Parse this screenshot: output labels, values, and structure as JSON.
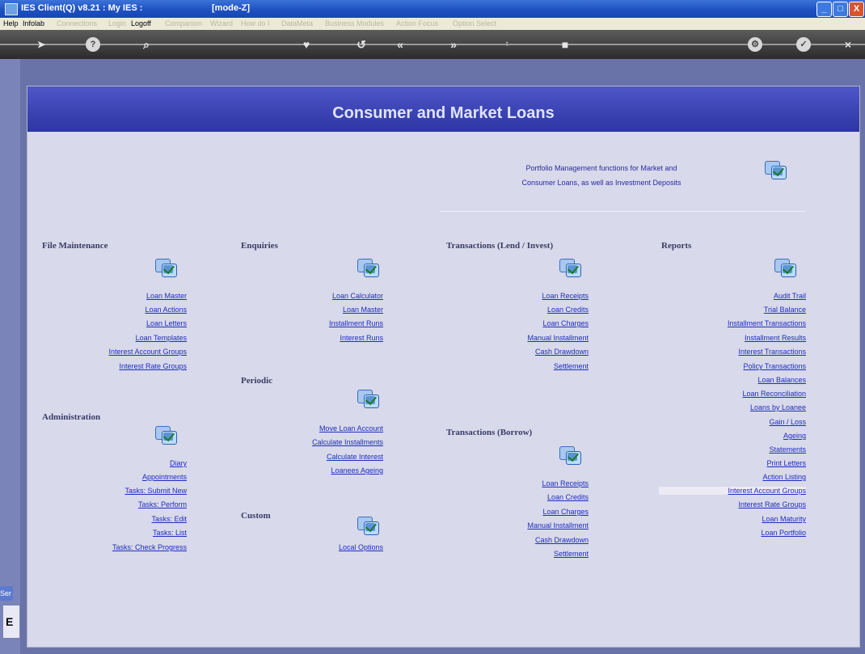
{
  "titlebar": {
    "title": "IES Client(Q) v8.21 : My IES :",
    "mode": "[mode-Z]",
    "min": "_",
    "max": "□",
    "close": "X"
  },
  "menu": [
    {
      "label": "Help",
      "enabled": true
    },
    {
      "label": "Infolab",
      "enabled": true
    },
    {
      "label": "Connections",
      "enabled": false
    },
    {
      "label": "Login",
      "enabled": false
    },
    {
      "label": "Logoff",
      "enabled": true
    },
    {
      "label": "Companion",
      "enabled": false
    },
    {
      "label": "Wizard",
      "enabled": false
    },
    {
      "label": "How do I",
      "enabled": false
    },
    {
      "label": "DataMeta",
      "enabled": false
    },
    {
      "label": "Business Modules",
      "enabled": false
    },
    {
      "label": "Action Focus",
      "enabled": false
    },
    {
      "label": "Option Select",
      "enabled": false
    }
  ],
  "toolbar": {
    "icons": [
      "arrow-right-icon",
      "help-icon",
      "search-icon",
      "heart-icon",
      "history-icon",
      "back-icon",
      "forward-icon",
      "up-icon",
      "bookmark-icon",
      "settings-icon",
      "check-icon",
      "close-icon"
    ],
    "help": "?",
    "search": "⌕",
    "heart": "♥",
    "history": "↺",
    "back": "«",
    "forward": "»",
    "check": "✓",
    "close": "×",
    "settings": "⚙"
  },
  "side": {
    "ser": "Ser",
    "e": "E"
  },
  "banner": {
    "title": "Consumer and Market Loans"
  },
  "intro": {
    "line1": "Portfolio Management functions for Market and",
    "line2": "Consumer Loans, as well as Investment Deposits"
  },
  "sections": {
    "file_maintenance": {
      "title": "File Maintenance",
      "links": [
        "Loan Master",
        "Loan Actions",
        "Loan Letters",
        "Loan Templates",
        "Interest Account Groups",
        "Interest Rate Groups"
      ]
    },
    "administration": {
      "title": "Administration",
      "links": [
        "Diary",
        "Appointments",
        "Tasks: Submit New",
        "Tasks: Perform",
        "Tasks: Edit",
        "Tasks: List",
        "Tasks: Check Progress"
      ]
    },
    "enquiries": {
      "title": "Enquiries",
      "links": [
        "Loan Calculator",
        "Loan Master",
        "Installment Runs",
        "Interest Runs"
      ]
    },
    "periodic": {
      "title": "Periodic",
      "links": [
        "Move Loan Account",
        "Calculate Installments",
        "Calculate Interest",
        "Loanees Ageing"
      ]
    },
    "custom": {
      "title": "Custom",
      "links": [
        "Local Options"
      ]
    },
    "transactions_lend": {
      "title": "Transactions (Lend / Invest)",
      "links": [
        "Loan Receipts",
        "Loan Credits",
        "Loan Charges",
        "Manual Installment",
        "Cash Drawdown",
        "Settlement"
      ]
    },
    "transactions_borrow": {
      "title": "Transactions (Borrow)",
      "links": [
        "Loan Receipts",
        "Loan Credits",
        "Loan Charges",
        "Manual Installment",
        "Cash Drawdown",
        "Settlement"
      ]
    },
    "reports": {
      "title": "Reports",
      "links": [
        "Audit Trail",
        "Trial Balance",
        "Installment Transactions",
        "Installment Results",
        "Interest Transactions",
        "Policy Transactions",
        "Loan Balances",
        "Loan Reconciliation",
        "Loans by Loanee",
        "Gain / Loss",
        "Ageing",
        "Statements",
        "Print Letters",
        "Action Listing",
        "Interest Account Groups",
        "Interest Rate Groups",
        "Loan Maturity",
        "Loan Portfolio"
      ]
    }
  },
  "colors": {
    "banner": "#2d36a3",
    "panel": "#d8d9ea",
    "link": "#1e2dbf",
    "heading": "#3b3c66"
  }
}
